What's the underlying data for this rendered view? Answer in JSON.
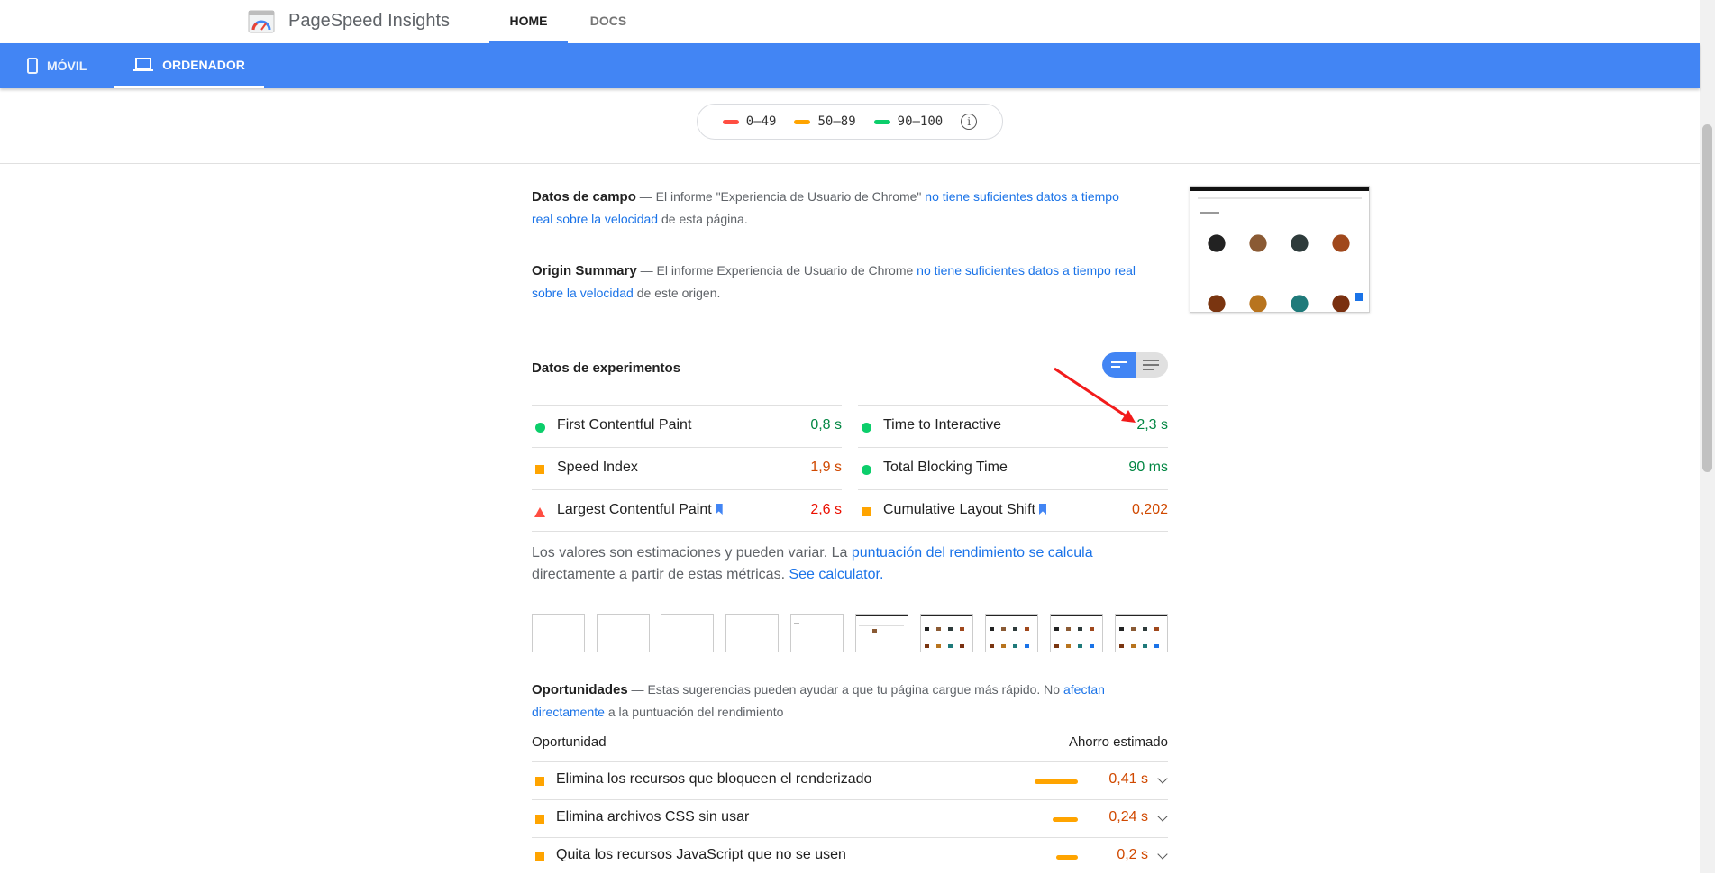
{
  "header": {
    "brand": "PageSpeed Insights",
    "nav": [
      "HOME",
      "DOCS"
    ]
  },
  "device_tabs": [
    "MÓVIL",
    "ORDENADOR"
  ],
  "legend": {
    "ranges": [
      {
        "label": "0–49",
        "color": "#ff4e42"
      },
      {
        "label": "50–89",
        "color": "#ffa400"
      },
      {
        "label": "90–100",
        "color": "#0cce6b"
      }
    ]
  },
  "field_data": {
    "title": "Datos de campo",
    "dash": " — El informe \"Experiencia de Usuario de Chrome\" ",
    "link": "no tiene suficientes datos a tiempo real sobre la velocidad",
    "tail": " de esta página."
  },
  "origin_summary": {
    "title": "Origin Summary",
    "dash": " — El informe Experiencia de Usuario de Chrome ",
    "link": "no tiene suficientes datos a tiempo real sobre la velocidad",
    "tail": " de este origen."
  },
  "lab": {
    "title": "Datos de experimentos",
    "metrics": [
      {
        "name": "First Contentful Paint",
        "value": "0,8 s",
        "rating": "pass"
      },
      {
        "name": "Time to Interactive",
        "value": "2,3 s",
        "rating": "pass"
      },
      {
        "name": "Speed Index",
        "value": "1,9 s",
        "rating": "avg"
      },
      {
        "name": "Total Blocking Time",
        "value": "90 ms",
        "rating": "pass"
      },
      {
        "name": "Largest Contentful Paint",
        "value": "2,6 s",
        "rating": "fail"
      },
      {
        "name": "Cumulative Layout Shift",
        "value": "0,202",
        "rating": "avg"
      }
    ],
    "note_text": "Los valores son estimaciones y pueden variar. La ",
    "note_link": "puntuación del rendimiento se calcula",
    "note_text2": " directamente a partir de estas métricas. ",
    "note_link2": "See calculator."
  },
  "opportunities": {
    "title": "Oportunidades",
    "dash": " — Estas sugerencias pueden ayudar a que tu página cargue más rápido. No ",
    "link": "afectan directamente",
    "tail": " a la puntuación del rendimiento",
    "col_left": "Oportunidad",
    "col_right": "Ahorro estimado",
    "items": [
      {
        "name": "Elimina los recursos que bloqueen el renderizado",
        "value": "0,41 s",
        "fraction": 1.0
      },
      {
        "name": "Elimina archivos CSS sin usar",
        "value": "0,24 s",
        "fraction": 0.58
      },
      {
        "name": "Quita los recursos JavaScript que no se usen",
        "value": "0,2 s",
        "fraction": 0.49
      }
    ]
  }
}
